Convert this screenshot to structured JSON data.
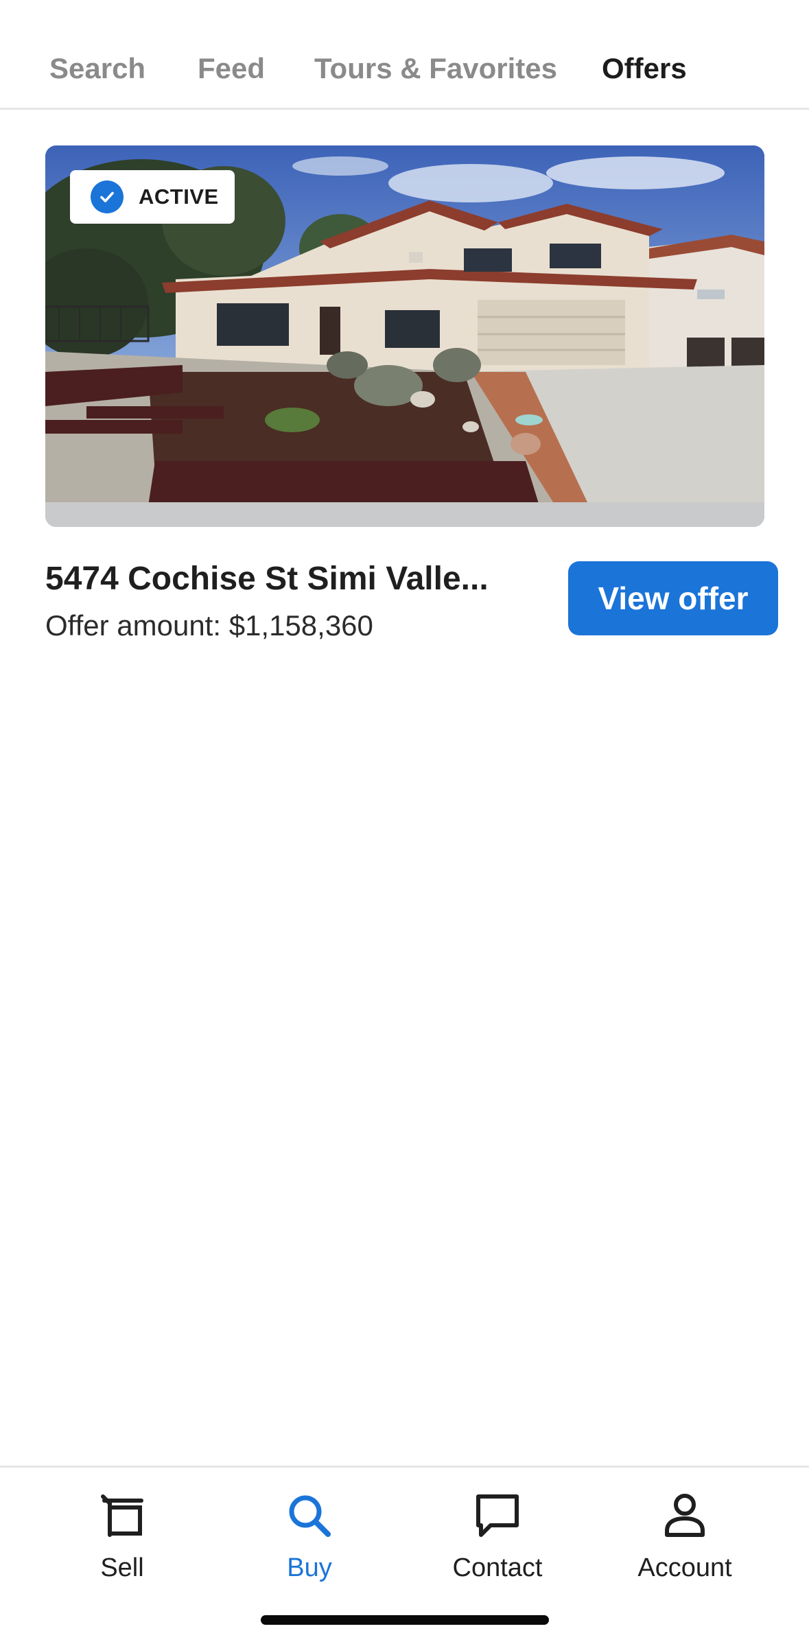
{
  "top_tabs": [
    {
      "label": "Search",
      "active": false
    },
    {
      "label": "Feed",
      "active": false
    },
    {
      "label": "Tours & Favorites",
      "active": false
    },
    {
      "label": "Offers",
      "active": true
    }
  ],
  "offer": {
    "status": "ACTIVE",
    "address": "5474 Cochise St Simi Valle...",
    "offer_amount": "Offer amount: $1,158,360",
    "view_offer_label": "View offer"
  },
  "bottom_nav": [
    {
      "label": "Sell",
      "icon": "sell-icon",
      "active": false
    },
    {
      "label": "Buy",
      "icon": "search-icon",
      "active": true
    },
    {
      "label": "Contact",
      "icon": "chat-icon",
      "active": false
    },
    {
      "label": "Account",
      "icon": "person-icon",
      "active": false
    }
  ],
  "colors": {
    "accent": "#1b74d8",
    "inactive_tab": "#8a8a8a",
    "text": "#1f1f1f"
  }
}
